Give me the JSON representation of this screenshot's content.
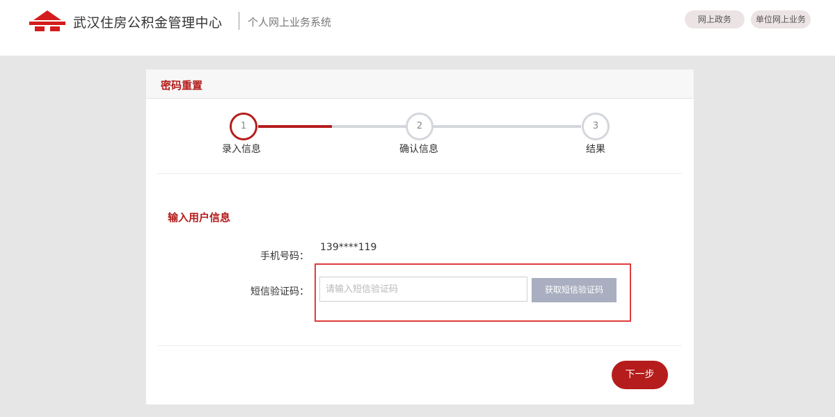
{
  "header": {
    "brand_name": "武汉住房公积金管理中心",
    "system_name": "个人网上业务系统",
    "nav_buttons": [
      "网上政务",
      "单位网上业务"
    ]
  },
  "card": {
    "title": "密码重置",
    "steps": [
      {
        "number": "1",
        "label": "录入信息",
        "state": "active"
      },
      {
        "number": "2",
        "label": "确认信息",
        "state": "pending"
      },
      {
        "number": "3",
        "label": "结果",
        "state": "pending"
      }
    ],
    "section_title": "输入用户信息",
    "form": {
      "phone_label": "手机号码：",
      "phone_value": "139****119",
      "sms_label": "短信验证码：",
      "sms_placeholder": "请输入短信验证码",
      "sms_value": "",
      "sms_button": "获取短信验证码"
    },
    "next_button": "下一步"
  },
  "colors": {
    "brand_red": "#b51c1c",
    "highlight_border": "#e03b3b",
    "pending_gray": "#d4d6dc",
    "sms_button_bg": "#a9afc0",
    "page_bg": "#e6e6e6"
  },
  "icons": {
    "logo": "housing-fund-logo-icon"
  }
}
